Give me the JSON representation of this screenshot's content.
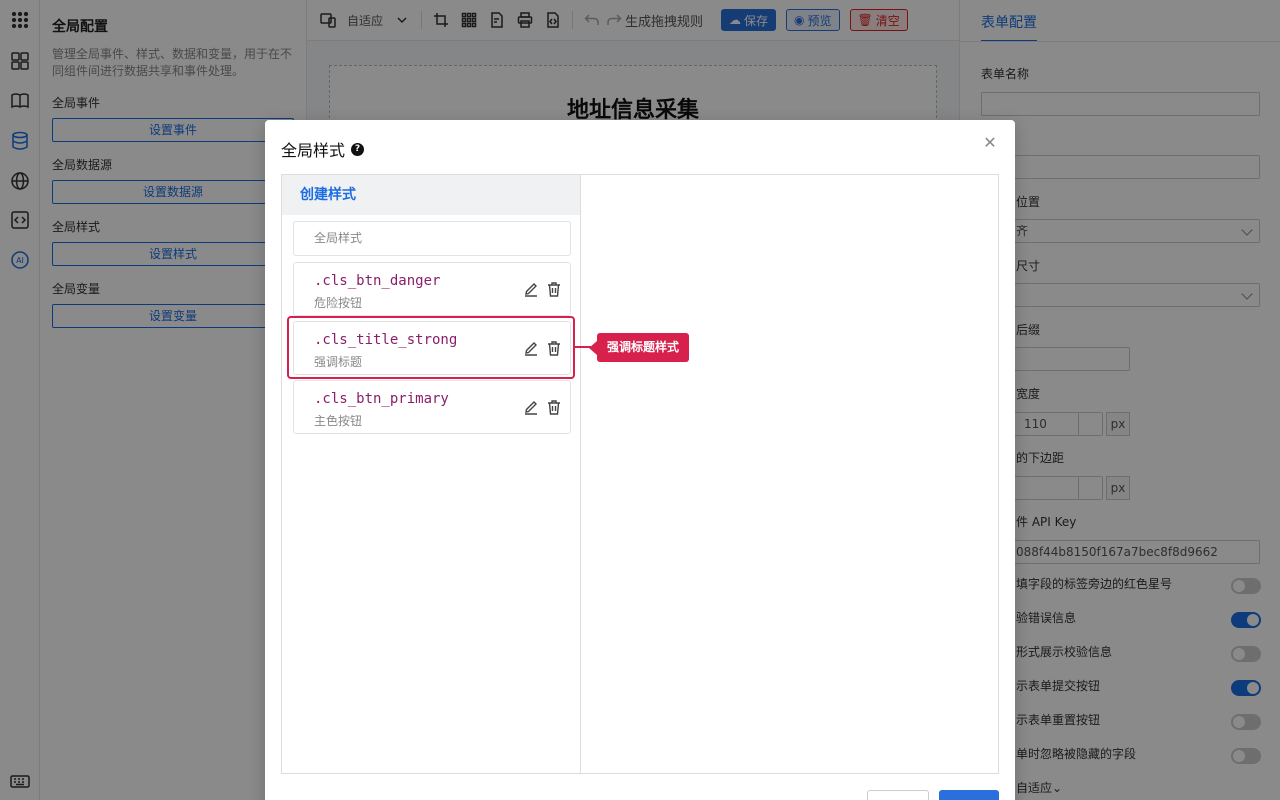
{
  "global_panel": {
    "title": "全局配置",
    "description": "管理全局事件、样式、数据和变量，用于在不同组件间进行数据共享和事件处理。",
    "sections": [
      {
        "label": "全局事件",
        "button": "设置事件"
      },
      {
        "label": "全局数据源",
        "button": "设置数据源"
      },
      {
        "label": "全局样式",
        "button": "设置样式"
      },
      {
        "label": "全局变量",
        "button": "设置变量"
      }
    ]
  },
  "toolbar": {
    "device_mode": "自适应",
    "generate_rule": "生成拖拽规则",
    "save": "保存",
    "preview": "预览",
    "clear": "清空"
  },
  "canvas": {
    "form_title": "地址信息采集"
  },
  "right_panel": {
    "tab": "表单配置",
    "form_name_label": "表单名称",
    "label_position_label": "位置",
    "label_position_value": "齐",
    "size_label": "尺寸",
    "suffix_label": "后缀",
    "label_width_label": "宽度",
    "label_width_value": "110",
    "unit_px": "px",
    "bottom_margin_label": "的下边距",
    "api_key_label": "件 API Key",
    "api_key_value": "088f44b8150f167a7bec8f8d9662",
    "switches": [
      {
        "label": "填字段的标签旁边的红色星号",
        "on": false
      },
      {
        "label": "验错误信息",
        "on": true
      },
      {
        "label": "形式展示校验信息",
        "on": false
      },
      {
        "label": "示表单提交按钮",
        "on": true
      },
      {
        "label": "示表单重置按钮",
        "on": false
      },
      {
        "label": "单时忽略被隐藏的字段",
        "on": false
      }
    ],
    "footer_select": "自适应"
  },
  "modal": {
    "title": "全局样式",
    "create_tab": "创建样式",
    "global_style_item": "全局样式",
    "classes": [
      {
        "name": ".cls_btn_danger",
        "desc": "危险按钮"
      },
      {
        "name": ".cls_title_strong",
        "desc": "强调标题"
      },
      {
        "name": ".cls_btn_primary",
        "desc": "主色按钮"
      }
    ]
  },
  "annotation": {
    "label": "强调标题样式"
  }
}
